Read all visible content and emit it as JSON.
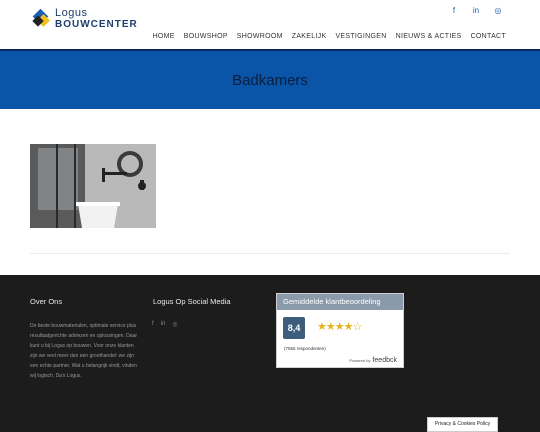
{
  "logo": {
    "line1": "Logus",
    "line2": "BOUWCENTER"
  },
  "header_social": [
    {
      "icon": "facebook-icon",
      "glyph": "f"
    },
    {
      "icon": "linkedin-icon",
      "glyph": "in"
    },
    {
      "icon": "instagram-icon",
      "glyph": "◎"
    }
  ],
  "nav": [
    "HOME",
    "BOUWSHOP",
    "SHOWROOM",
    "ZAKELIJK",
    "VESTIGINGEN",
    "NIEUWS & ACTIES",
    "CONTACT"
  ],
  "hero": {
    "title": "Badkamers"
  },
  "footer": {
    "about_title": "Over Ons",
    "about_text": "De beste bouwmaterialen, optimale service plus resultaatgerichte adviezen en oplossingen. Daar kunt u bij Logus op bouwen. Voor onze klanten zijn we veel meer dan een groothandel: we zijn een echte partner. Wat u belangrijk vindt, vinden wij logisch. Da's Logus.",
    "social_title": "Logus Op Social Media",
    "social_icons": [
      {
        "icon": "facebook-icon",
        "glyph": "f"
      },
      {
        "icon": "linkedin-icon",
        "glyph": "in"
      },
      {
        "icon": "instagram-icon",
        "glyph": "◎"
      }
    ]
  },
  "review_widget": {
    "header": "Gemiddelde klantbeoordeling",
    "score": "8,4",
    "stars": "★★★★☆",
    "respondents": "(7555 respondenten)",
    "powered_by": "Powered by",
    "brand": "feedbck"
  },
  "cookie_button": "Privacy & Cookies Policy",
  "colors": {
    "brand_blue": "#0b55a8",
    "footer_bg": "#1c1c1c",
    "star": "#e6b422"
  }
}
